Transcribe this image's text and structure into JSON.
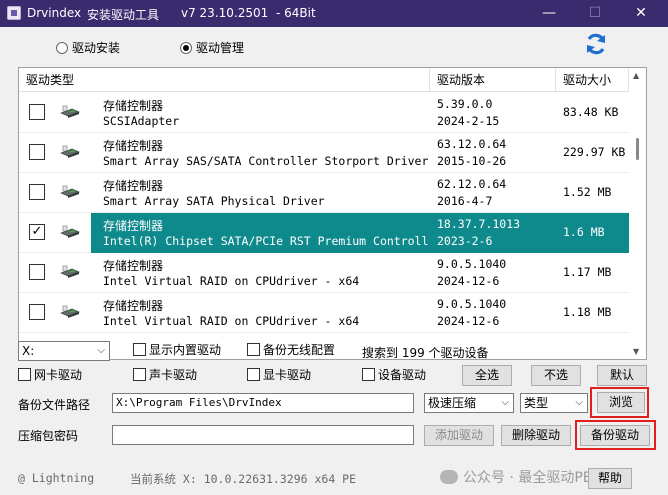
{
  "window": {
    "title_app": "Drvindex",
    "title_tool": "安装驱动工具",
    "title_version": "v7  23.10.2501",
    "title_bits": "- 64Bit",
    "minimize_glyph": "—",
    "maximize_glyph": "☐",
    "close_glyph": "✕"
  },
  "mode": {
    "install_label": "驱动安装",
    "manage_label": "驱动管理",
    "selected": "manage"
  },
  "table": {
    "columns": [
      "驱动类型",
      "驱动版本",
      "驱动大小"
    ],
    "rows": [
      {
        "checked": false,
        "category": "存储控制器",
        "name": "SCSIAdapter",
        "version": "5.39.0.0",
        "date": "2024-2-15",
        "size": "83.48 KB",
        "selected": false
      },
      {
        "checked": false,
        "category": "存储控制器",
        "name": "Smart Array SAS/SATA Controller Storport Driver",
        "version": "63.12.0.64",
        "date": "2015-10-26",
        "size": "229.97 KB",
        "selected": false
      },
      {
        "checked": false,
        "category": "存储控制器",
        "name": "Smart Array SATA Physical Driver",
        "version": "62.12.0.64",
        "date": "2016-4-7",
        "size": "1.52 MB",
        "selected": false
      },
      {
        "checked": true,
        "category": "存储控制器",
        "name": "Intel(R) Chipset SATA/PCIe RST Premium Controller",
        "version": "18.37.7.1013",
        "date": "2023-2-6",
        "size": "1.6 MB",
        "selected": true
      },
      {
        "checked": false,
        "category": "存储控制器",
        "name": "Intel Virtual RAID on CPUdriver - x64",
        "version": "9.0.5.1040",
        "date": "2024-12-6",
        "size": "1.17 MB",
        "selected": false
      },
      {
        "checked": false,
        "category": "存储控制器",
        "name": "Intel Virtual RAID on CPUdriver - x64",
        "version": "9.0.5.1040",
        "date": "2024-12-6",
        "size": "1.18 MB",
        "selected": false
      }
    ],
    "checkmark": "✓"
  },
  "filters": {
    "drive_combo": "X:",
    "show_builtin": "显示内置驱动",
    "backup_wireless": "备份无线配置",
    "search_result": "搜索到 199 个驱动设备",
    "net_driver": "网卡驱动",
    "sound_driver": "声卡驱动",
    "display_driver": "显卡驱动",
    "device_driver": "设备驱动",
    "select_all": "全选",
    "select_none": "不选",
    "default": "默认"
  },
  "backup": {
    "path_label": "备份文件路径",
    "path_value": "X:\\Program Files\\DrvIndex",
    "compression_combo": "极速压缩",
    "type_combo": "类型",
    "browse": "浏览",
    "password_label": "压缩包密码",
    "password_value": "",
    "add_driver": "添加驱动",
    "delete_driver": "删除驱动",
    "backup_driver": "备份驱动"
  },
  "status": {
    "author": "@ Lightning",
    "system_info": "当前系统 X: 10.0.22631.3296 x64  PE",
    "help": "帮助",
    "watermark": "公众号 · 最全驱动PE"
  },
  "colors": {
    "title_bar": "#3a2a6e",
    "selection": "#0f8a8c",
    "highlight_border": "#e02020"
  }
}
